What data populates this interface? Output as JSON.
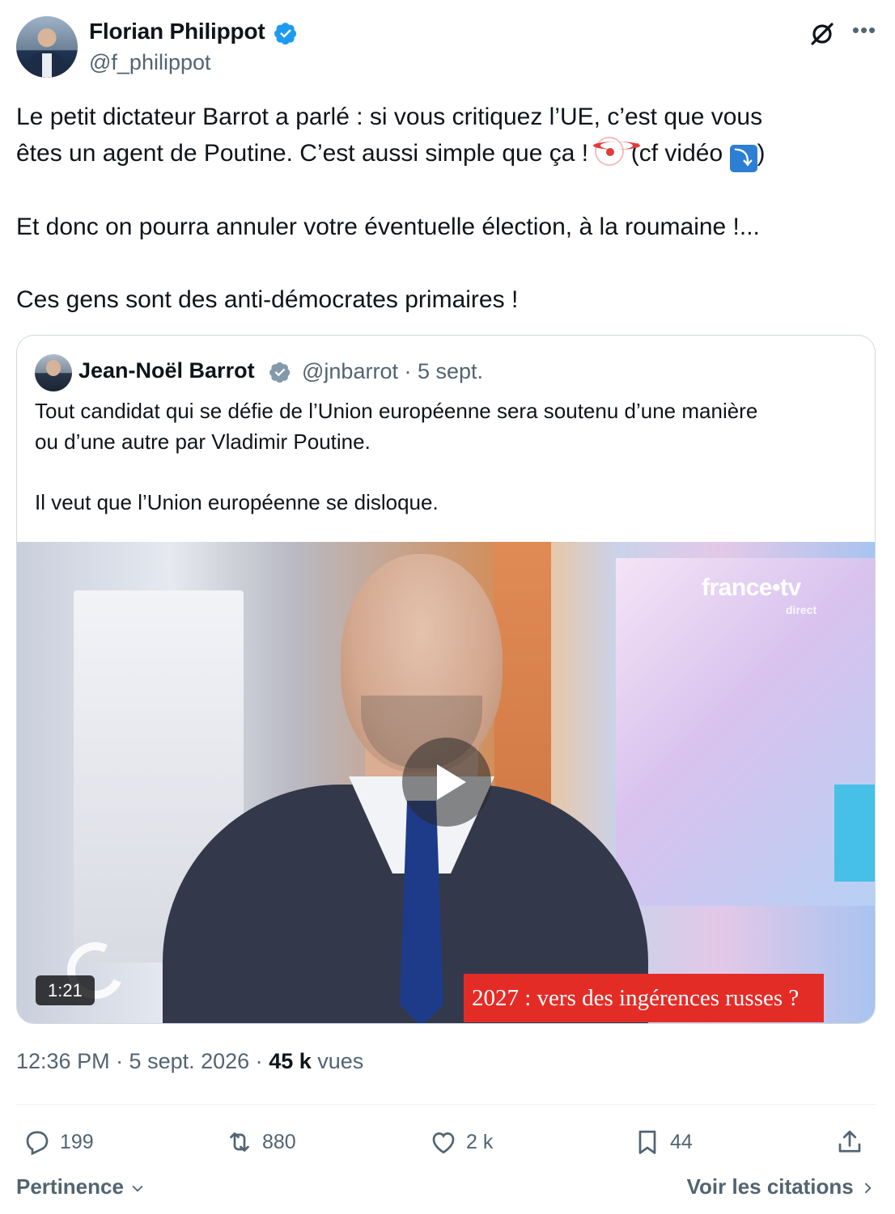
{
  "author": {
    "name": "Florian Philippot",
    "handle": "@f_philippot"
  },
  "header_icons": [
    "grok-icon",
    "more-icon"
  ],
  "tweet": {
    "line1": "Le petit dictateur Barrot a parlé : si vous critiquez l’UE, c’est que vous",
    "line2_before": "êtes un agent de Poutine. C’est aussi simple que ça ! ",
    "line2_after": " (cf vidéo ",
    "line2_end": ")",
    "down_arrow_glyph": "⤵",
    "paragraph2": "Et donc on pourra annuler votre éventuelle élection, à la roumaine !...",
    "paragraph3": "Ces gens sont des anti-démocrates primaires !"
  },
  "quoted": {
    "name": "Jean-Noël Barrot",
    "meta": "@jnbarrot · 5 sept.",
    "text1": "Tout candidat qui se défie de l’Union européenne sera soutenu d’une manière",
    "text2": "ou d’une autre par Vladimir Poutine.",
    "text3": "Il veut que l’Union européenne se disloque.",
    "video": {
      "channel_logo": "france•tv",
      "channel_sub": "direct",
      "duration": "1:21",
      "banner": "2027 : vers des ingérences russes ?"
    }
  },
  "timestamp": {
    "time_date": "12:36 PM · 5 sept. 2026 · ",
    "views_count": "45 k",
    "views_label": " vues"
  },
  "actions": {
    "replies": "199",
    "reposts": "880",
    "likes": "2 k",
    "bookmarks": "44"
  },
  "footer": {
    "sort_label": "Pertinence",
    "quotes_link": "Voir les citations"
  },
  "colors": {
    "verified_blue": "#1d9bf0",
    "secondary_text": "#536471",
    "banner_red": "#e42c27"
  }
}
